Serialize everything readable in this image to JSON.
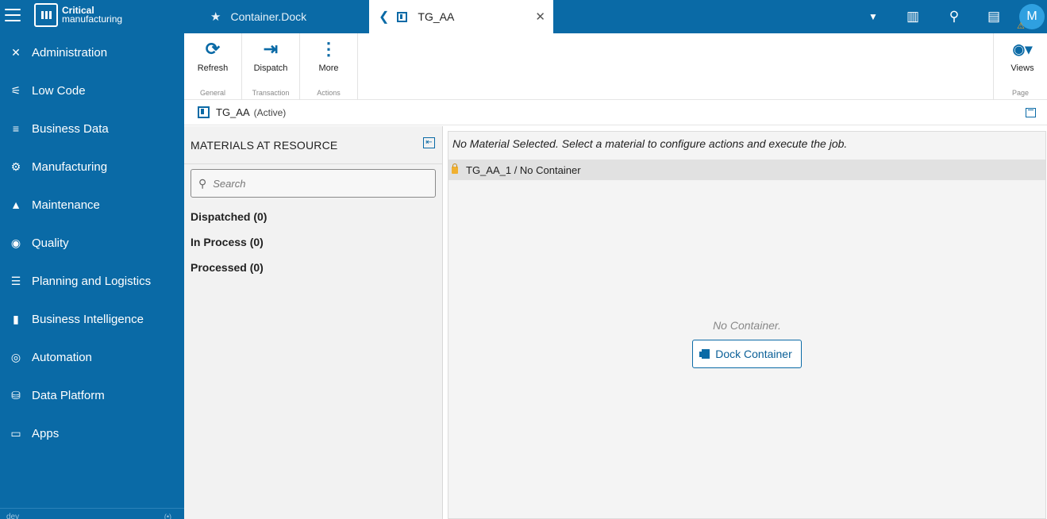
{
  "brand": {
    "line1": "Critical",
    "line2": "manufacturing"
  },
  "sidebar": {
    "items": [
      {
        "label": "Administration",
        "icon": "✕"
      },
      {
        "label": "Low Code",
        "icon": "⚟"
      },
      {
        "label": "Business Data",
        "icon": "≡"
      },
      {
        "label": "Manufacturing",
        "icon": "⚙"
      },
      {
        "label": "Maintenance",
        "icon": "▲"
      },
      {
        "label": "Quality",
        "icon": "◉"
      },
      {
        "label": "Planning and Logistics",
        "icon": "☰"
      },
      {
        "label": "Business Intelligence",
        "icon": "▮"
      },
      {
        "label": "Automation",
        "icon": "◎"
      },
      {
        "label": "Data Platform",
        "icon": "⛁"
      },
      {
        "label": "Apps",
        "icon": "▭"
      }
    ],
    "env": "dev",
    "signal": "(•)"
  },
  "tabs": [
    {
      "label": "Container.Dock",
      "icon": "★"
    },
    {
      "label": "TG_AA",
      "back": "❮",
      "close": "✕"
    }
  ],
  "topbar": {
    "dropdown_icon": "▼",
    "barcode_icon": "▥",
    "search_icon": "⚲",
    "chat_icon": "▤",
    "avatar_letter": "M",
    "warning_icon": "⚠"
  },
  "toolbar": {
    "groups": [
      {
        "label": "General",
        "buttons": [
          {
            "label": "Refresh",
            "icon": "⟳"
          }
        ]
      },
      {
        "label": "Transaction",
        "buttons": [
          {
            "label": "Dispatch",
            "icon": "⇥"
          }
        ]
      },
      {
        "label": "Actions",
        "buttons": [
          {
            "label": "More",
            "icon": "⋮"
          }
        ]
      },
      {
        "label": "Page",
        "buttons": [
          {
            "label": "Views",
            "icon": "◉▾"
          }
        ]
      }
    ]
  },
  "entity": {
    "name": "TG_AA",
    "state": "(Active)"
  },
  "left_panel": {
    "title": "MATERIALS AT RESOURCE",
    "collapse_icon": "⇤",
    "search": {
      "placeholder": "Search",
      "value": "",
      "icon": "⚲"
    },
    "groups": [
      "Dispatched (0)",
      "In Process (0)",
      "Processed (0)"
    ]
  },
  "right_panel": {
    "message": "No Material Selected. Select a material to configure actions and execute the job.",
    "row_text": "TG_AA_1 / No Container",
    "empty_text": "No Container.",
    "dock_button": "Dock Container"
  }
}
